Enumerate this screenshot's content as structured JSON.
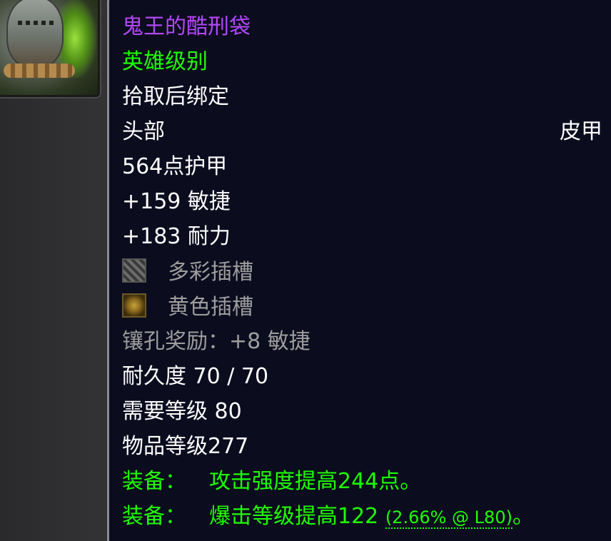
{
  "item": {
    "name": "鬼王的酷刑袋",
    "quality": "英雄级别",
    "binding": "拾取后绑定",
    "slot": "头部",
    "armor_type": "皮甲",
    "armor": "564点护甲",
    "stats": [
      "+159 敏捷",
      "+183 耐力"
    ],
    "sockets": [
      {
        "icon": "prismatic-socket-icon",
        "label": "多彩插槽"
      },
      {
        "icon": "yellow-socket-icon",
        "label": "黄色插槽"
      }
    ],
    "socket_bonus": "镶孔奖励：+8 敏捷",
    "durability": "耐久度 70 / 70",
    "required_level": "需要等级 80",
    "item_level": "物品等级277",
    "equip_effects": [
      {
        "prefix": "装备：",
        "text": "攻击强度提高244点。",
        "detail": "",
        "suffix": ""
      },
      {
        "prefix": "装备：",
        "text": "爆击等级提高122",
        "detail": "(2.66% @ L80)",
        "suffix": "。"
      }
    ]
  },
  "colors": {
    "epic_name": "#b048f8",
    "green": "#1eff00",
    "white": "#ffffff",
    "grey": "#9d9d9d",
    "tooltip_bg": "#0b0c1e"
  }
}
